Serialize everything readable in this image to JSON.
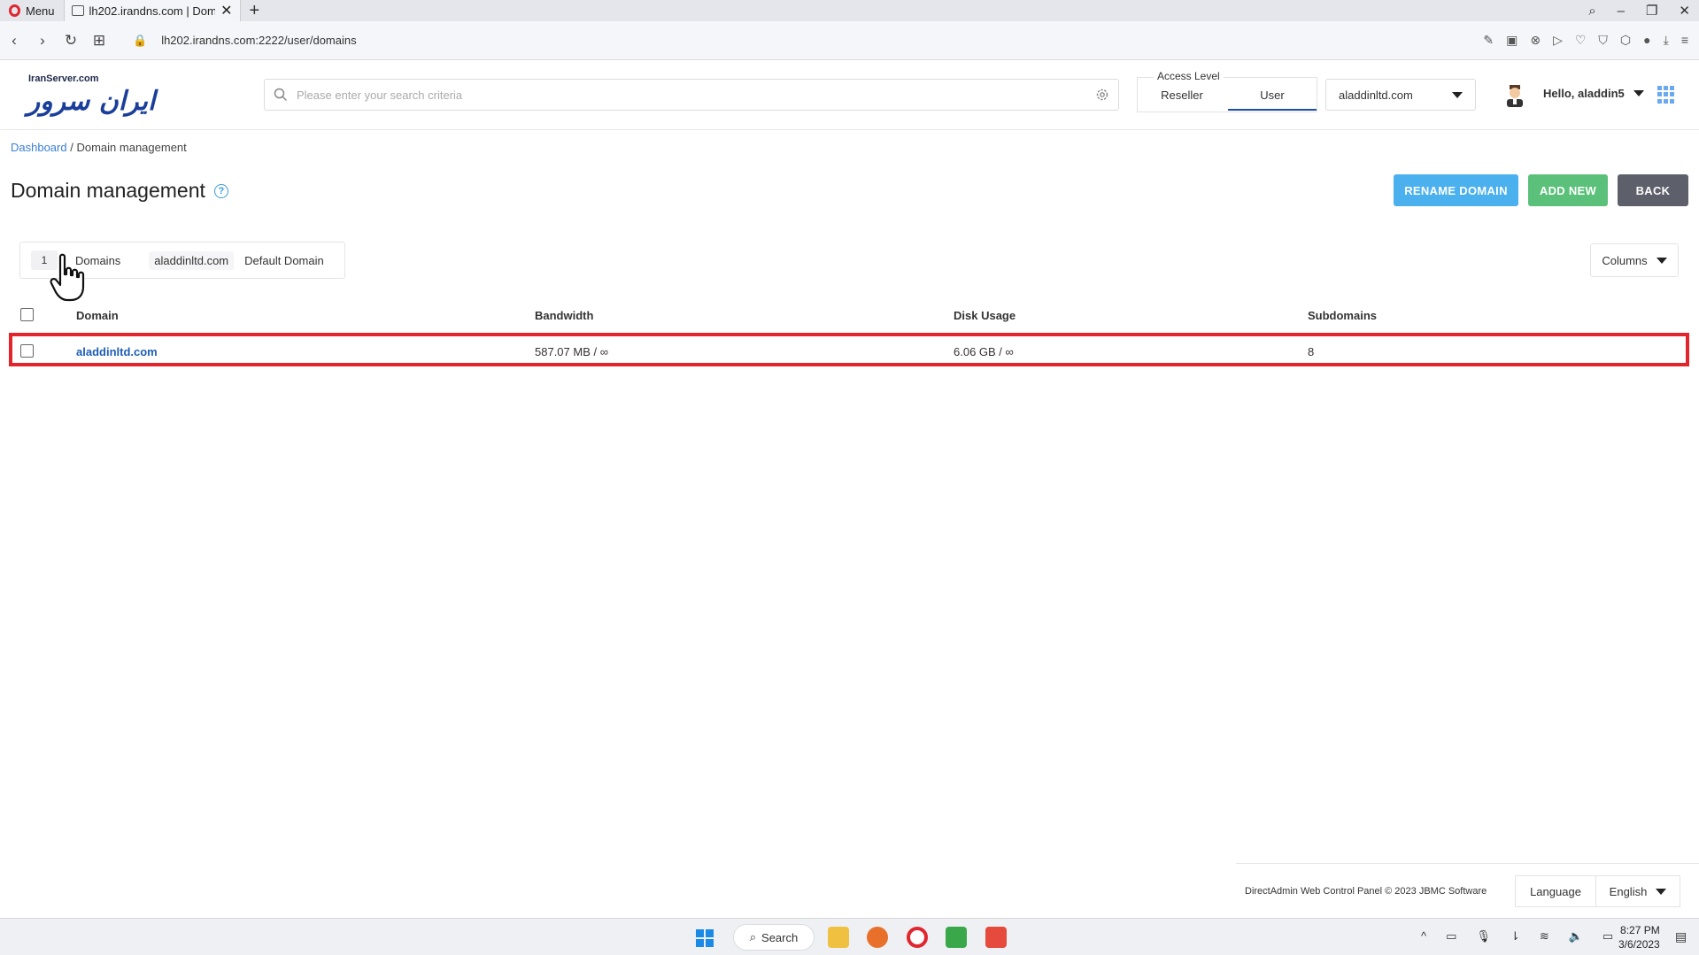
{
  "browser": {
    "menu_label": "Menu",
    "tab_title": "lh202.irandns.com | Domain",
    "url": "lh202.irandns.com:2222/user/domains"
  },
  "header": {
    "logo_text_en": "IranServer.com",
    "logo_text_fa": "ایران سرور",
    "search_placeholder": "Please enter your search criteria",
    "access_level": {
      "legend": "Access Level",
      "options": [
        "Reseller",
        "User"
      ],
      "selected": "User"
    },
    "domain_select": "aladdinltd.com",
    "greeting": "Hello, aladdin5"
  },
  "breadcrumb": {
    "root": "Dashboard",
    "separator": "/",
    "current": "Domain management"
  },
  "page": {
    "title": "Domain management",
    "buttons": {
      "rename": "RENAME DOMAIN",
      "add": "ADD NEW",
      "back": "BACK"
    }
  },
  "filter": {
    "count": "1",
    "label": "Domains",
    "chip": "aladdinltd.com",
    "chip2": "Default Domain",
    "columns_label": "Columns"
  },
  "table": {
    "headers": [
      "Domain",
      "Bandwidth",
      "Disk Usage",
      "Subdomains"
    ],
    "rows": [
      {
        "domain": "aladdinltd.com",
        "bandwidth": "587.07 MB / ∞",
        "disk_usage": "6.06 GB / ∞",
        "subdomains": "8"
      }
    ]
  },
  "footer": {
    "copyright": "DirectAdmin Web Control Panel © 2023 JBMC Software",
    "language_label": "Language",
    "language_value": "English"
  },
  "taskbar": {
    "search_label": "Search",
    "time": "8:27 PM",
    "date": "3/6/2023"
  },
  "colors": {
    "rename_button": "#4ab0ee",
    "add_button": "#5bc07a",
    "back_button": "#5d5f6a",
    "highlight_border": "#e3252b",
    "link": "#1e5fb5"
  }
}
